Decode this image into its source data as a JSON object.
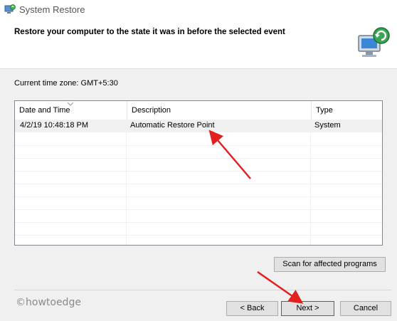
{
  "window": {
    "title": "System Restore",
    "icon": "system-restore-icon"
  },
  "header": {
    "instruction": "Restore your computer to the state it was in before the selected event",
    "icon": "restore-computer-icon"
  },
  "timezone": "Current time zone: GMT+5:30",
  "table": {
    "columns": [
      "Date and Time",
      "Description",
      "Type"
    ],
    "sorted_column": "Date and Time",
    "rows": [
      {
        "date": "4/2/19 10:48:18 PM",
        "description": "Automatic Restore Point",
        "type": "System",
        "selected": true
      }
    ]
  },
  "buttons": {
    "scan": "Scan for affected programs",
    "back": "< Back",
    "next": "Next >",
    "cancel": "Cancel"
  },
  "watermark": "©howtoedge",
  "colors": {
    "annotation_arrow": "#e41f1f",
    "focus_border": "#0078d7"
  }
}
